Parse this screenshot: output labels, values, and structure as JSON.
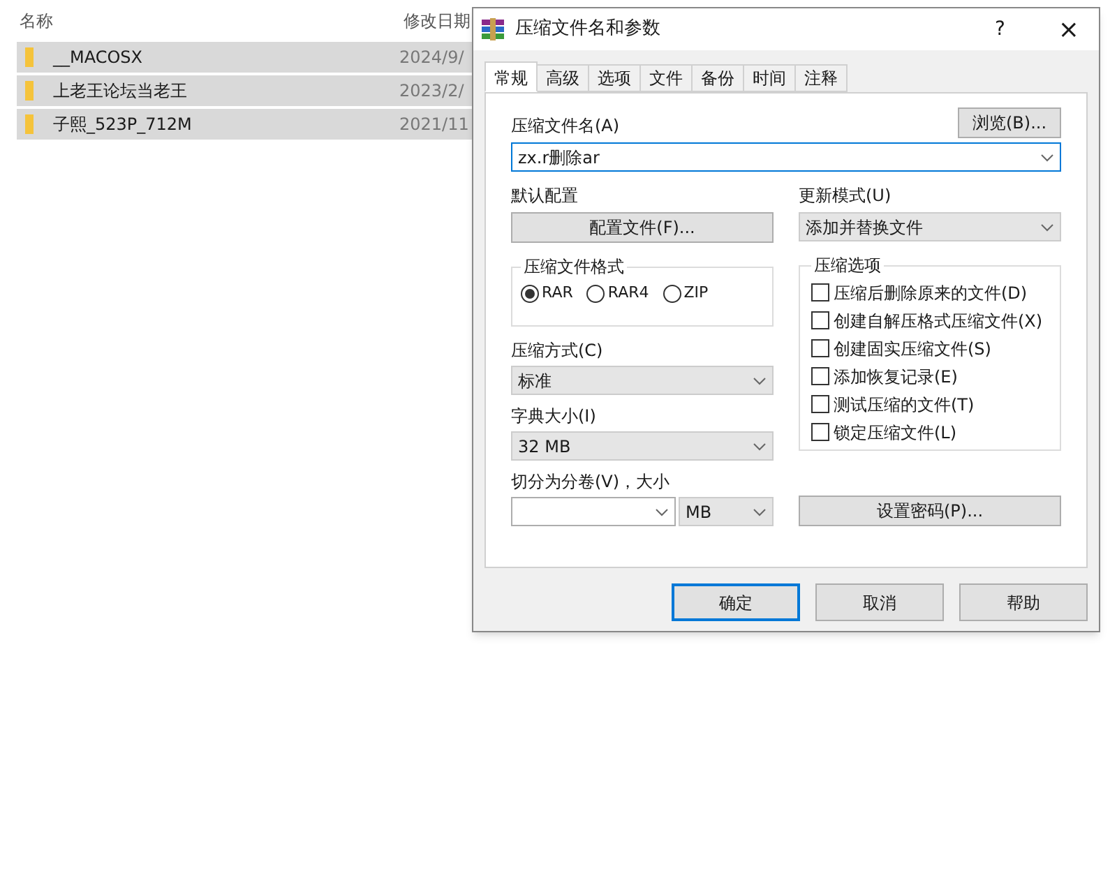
{
  "explorer": {
    "columns": [
      "名称",
      "修改日期"
    ],
    "rows": [
      {
        "name": "__MACOSX",
        "date": "2024/9/",
        "selected": true
      },
      {
        "name": "上老王论坛当老王",
        "date": "2023/2/",
        "selected": true
      },
      {
        "name": "子熙_523P_712M",
        "date": "2021/11",
        "selected": true
      }
    ]
  },
  "dialog": {
    "title": "压缩文件名和参数",
    "help": "?",
    "close": "×",
    "tabs": [
      {
        "label": "常规",
        "selected": true
      },
      {
        "label": "高级",
        "selected": false
      },
      {
        "label": "选项",
        "selected": false
      },
      {
        "label": "文件",
        "selected": false
      },
      {
        "label": "备份",
        "selected": false
      },
      {
        "label": "时间",
        "selected": false
      },
      {
        "label": "注释",
        "selected": false
      }
    ],
    "archive_name": {
      "label": "压缩文件名(A)",
      "value": "zx.r删除ar",
      "browse": "浏览(B)..."
    },
    "profile": {
      "label": "默认配置",
      "button": "配置文件(F)..."
    },
    "update_mode": {
      "label": "更新模式(U)",
      "value": "添加并替换文件"
    },
    "format": {
      "label": "压缩文件格式",
      "options": [
        {
          "label": "RAR",
          "selected": true
        },
        {
          "label": "RAR4",
          "selected": false
        },
        {
          "label": "ZIP",
          "selected": false
        }
      ]
    },
    "method": {
      "label": "压缩方式(C)",
      "value": "标准"
    },
    "dictionary": {
      "label": "字典大小(I)",
      "value": "32 MB"
    },
    "split": {
      "label": "切分为分卷(V)，大小",
      "unit": "MB"
    },
    "options": {
      "label": "压缩选项",
      "items": [
        {
          "label": "压缩后删除原来的文件(D)",
          "checked": false
        },
        {
          "label": "创建自解压格式压缩文件(X)",
          "checked": false
        },
        {
          "label": "创建固实压缩文件(S)",
          "checked": false
        },
        {
          "label": "添加恢复记录(E)",
          "checked": false
        },
        {
          "label": "测试压缩的文件(T)",
          "checked": false
        },
        {
          "label": "锁定压缩文件(L)",
          "checked": false
        }
      ]
    },
    "password": "设置密码(P)...",
    "buttons": [
      {
        "label": "确定",
        "kind": "default"
      },
      {
        "label": "取消",
        "kind": "normal"
      },
      {
        "label": "帮助",
        "kind": "normal"
      }
    ]
  }
}
